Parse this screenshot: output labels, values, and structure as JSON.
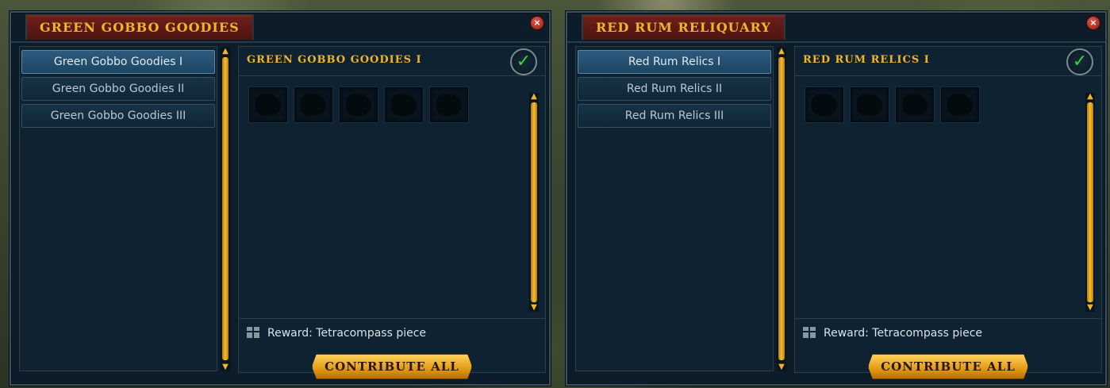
{
  "windows": [
    {
      "title": "GREEN GOBBO GOODIES",
      "tabs": [
        {
          "label": "Green Gobbo Goodies I",
          "active": true
        },
        {
          "label": "Green Gobbo Goodies II",
          "active": false
        },
        {
          "label": "Green Gobbo Goodies III",
          "active": false
        }
      ],
      "section_title": "GREEN GOBBO GOODIES I",
      "item_slots": [
        "item-silhouette",
        "item-silhouette",
        "item-silhouette",
        "item-silhouette",
        "item-silhouette"
      ],
      "reward": "Reward: Tetracompass piece",
      "contribute_label": "CONTRIBUTE ALL",
      "close_icon": "×",
      "check_icon": "✓"
    },
    {
      "title": "RED RUM RELIQUARY",
      "tabs": [
        {
          "label": "Red Rum Relics I",
          "active": true
        },
        {
          "label": "Red Rum Relics II",
          "active": false
        },
        {
          "label": "Red Rum Relics III",
          "active": false
        }
      ],
      "section_title": "RED RUM RELICS I",
      "item_slots": [
        "item-silhouette",
        "item-silhouette",
        "item-silhouette",
        "item-silhouette"
      ],
      "reward": "Reward: Tetracompass piece",
      "contribute_label": "CONTRIBUTE ALL",
      "close_icon": "×",
      "check_icon": "✓"
    }
  ],
  "colors": {
    "accent_gold": "#f3b42a",
    "title_tab": "#6d1f1a",
    "panel": "#0e2232",
    "check_green": "#3bd23b"
  }
}
